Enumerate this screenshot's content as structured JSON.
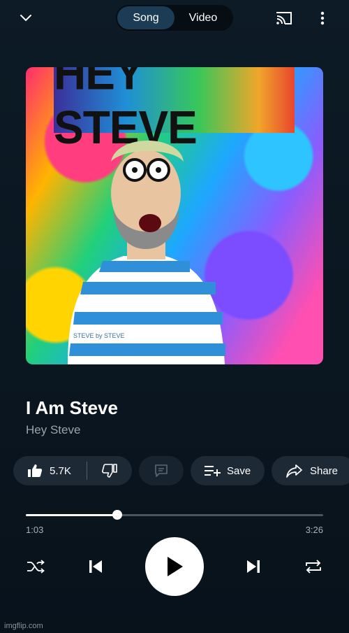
{
  "header": {
    "tabs": [
      {
        "label": "Song",
        "active": true
      },
      {
        "label": "Video",
        "active": false
      }
    ],
    "icons": {
      "collapse": "chevron-down-icon",
      "cast": "cast-icon",
      "more": "more-vert-icon"
    }
  },
  "album_art": {
    "title_text": "HEY STEVE",
    "shirt_text": "STEVE by STEVE"
  },
  "track": {
    "title": "I Am Steve",
    "artist": "Hey Steve"
  },
  "actions": {
    "like_count": "5.7K",
    "save_label": "Save",
    "share_label": "Share"
  },
  "playback": {
    "current_time": "1:03",
    "total_time": "3:26",
    "progress": 0.307
  },
  "watermark": "imgflip.com",
  "colors": {
    "background": "#0a1620",
    "active_tab": "#1c3c56",
    "pill": "#1d2a36",
    "secondary_text": "#9aa4ad"
  }
}
